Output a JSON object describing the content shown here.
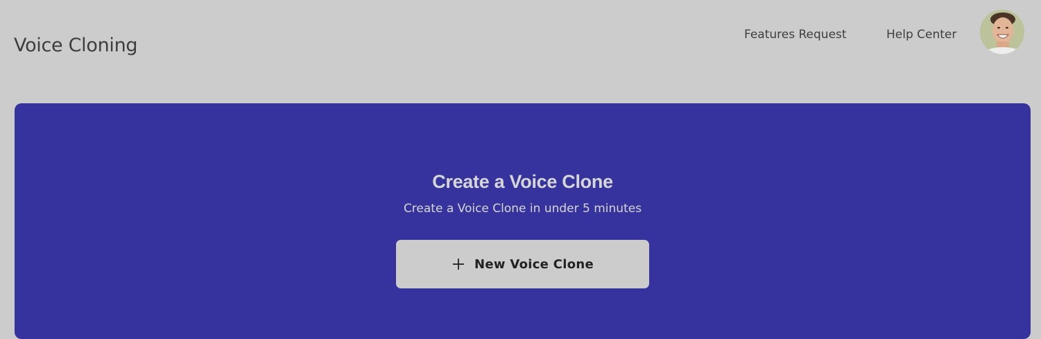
{
  "header": {
    "title": "Voice Cloning",
    "nav": {
      "features_request": "Features Request",
      "help_center": "Help Center"
    },
    "avatar_icon": "user-avatar"
  },
  "hero": {
    "title": "Create a Voice Clone",
    "subtitle": "Create a Voice Clone in under 5 minutes",
    "button": {
      "icon": "plus-icon",
      "label": "New Voice Clone"
    }
  },
  "colors": {
    "page_background": "#cccccc",
    "hero_background": "#37339e",
    "button_background": "#cccccc",
    "hero_text": "#d6d6d6"
  }
}
